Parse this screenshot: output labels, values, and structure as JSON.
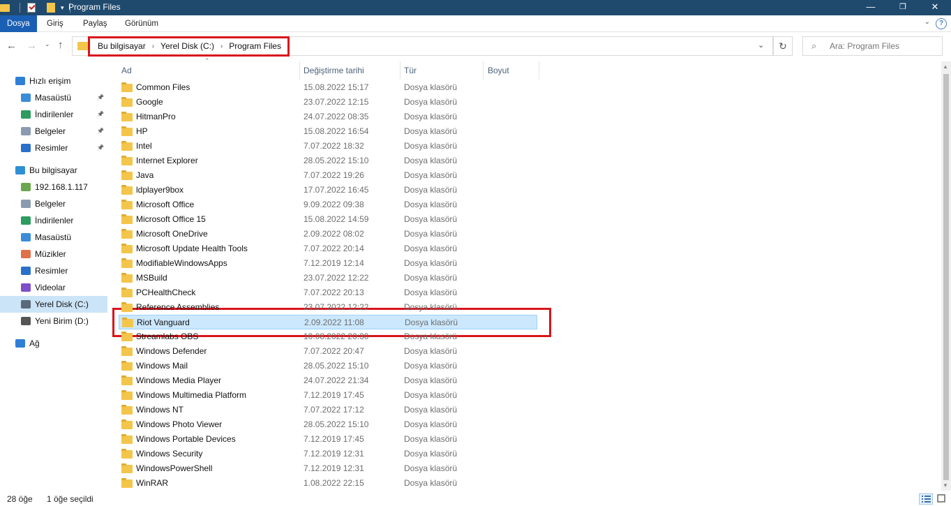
{
  "window": {
    "title": "Program Files",
    "minimize": "—",
    "maximize": "❐",
    "close": "✕"
  },
  "ribbon": {
    "tabs": [
      "Dosya",
      "Giriş",
      "Paylaş",
      "Görünüm"
    ]
  },
  "address": {
    "crumbs": [
      "Bu bilgisayar",
      "Yerel Disk (C:)",
      "Program Files"
    ]
  },
  "search": {
    "placeholder": "Ara: Program Files"
  },
  "sidebar": {
    "items": [
      {
        "label": "Hızlı erişim",
        "icon": "star-icon",
        "pinned": false
      },
      {
        "label": "Masaüstü",
        "icon": "desktop-icon",
        "pinned": true
      },
      {
        "label": "İndirilenler",
        "icon": "download-icon",
        "pinned": true
      },
      {
        "label": "Belgeler",
        "icon": "documents-icon",
        "pinned": true
      },
      {
        "label": "Resimler",
        "icon": "pictures-icon",
        "pinned": true
      },
      {
        "label": "Bu bilgisayar",
        "icon": "computer-icon",
        "pinned": false
      },
      {
        "label": "192.168.1.117",
        "icon": "network-drive-icon",
        "pinned": false
      },
      {
        "label": "Belgeler",
        "icon": "documents-icon",
        "pinned": false
      },
      {
        "label": "İndirilenler",
        "icon": "download-icon",
        "pinned": false
      },
      {
        "label": "Masaüstü",
        "icon": "desktop-icon",
        "pinned": false
      },
      {
        "label": "Müzikler",
        "icon": "music-icon",
        "pinned": false
      },
      {
        "label": "Resimler",
        "icon": "pictures-icon",
        "pinned": false
      },
      {
        "label": "Videolar",
        "icon": "videos-icon",
        "pinned": false
      },
      {
        "label": "Yerel Disk (C:)",
        "icon": "local-disk-icon",
        "pinned": false,
        "selected": true
      },
      {
        "label": "Yeni Birim (D:)",
        "icon": "drive-icon",
        "pinned": false
      },
      {
        "label": "Ağ",
        "icon": "network-icon",
        "pinned": false
      }
    ]
  },
  "columns": {
    "name": "Ad",
    "date": "Değiştirme tarihi",
    "type": "Tür",
    "size": "Boyut"
  },
  "files": [
    {
      "name": "Common Files",
      "date": "15.08.2022 15:17",
      "type": "Dosya klasörü"
    },
    {
      "name": "Google",
      "date": "23.07.2022 12:15",
      "type": "Dosya klasörü"
    },
    {
      "name": "HitmanPro",
      "date": "24.07.2022 08:35",
      "type": "Dosya klasörü"
    },
    {
      "name": "HP",
      "date": "15.08.2022 16:54",
      "type": "Dosya klasörü"
    },
    {
      "name": "Intel",
      "date": "7.07.2022 18:32",
      "type": "Dosya klasörü"
    },
    {
      "name": "Internet Explorer",
      "date": "28.05.2022 15:10",
      "type": "Dosya klasörü"
    },
    {
      "name": "Java",
      "date": "7.07.2022 19:26",
      "type": "Dosya klasörü"
    },
    {
      "name": "ldplayer9box",
      "date": "17.07.2022 16:45",
      "type": "Dosya klasörü"
    },
    {
      "name": "Microsoft Office",
      "date": "9.09.2022 09:38",
      "type": "Dosya klasörü"
    },
    {
      "name": "Microsoft Office 15",
      "date": "15.08.2022 14:59",
      "type": "Dosya klasörü"
    },
    {
      "name": "Microsoft OneDrive",
      "date": "2.09.2022 08:02",
      "type": "Dosya klasörü"
    },
    {
      "name": "Microsoft Update Health Tools",
      "date": "7.07.2022 20:14",
      "type": "Dosya klasörü"
    },
    {
      "name": "ModifiableWindowsApps",
      "date": "7.12.2019 12:14",
      "type": "Dosya klasörü"
    },
    {
      "name": "MSBuild",
      "date": "23.07.2022 12:22",
      "type": "Dosya klasörü"
    },
    {
      "name": "PCHealthCheck",
      "date": "7.07.2022 20:13",
      "type": "Dosya klasörü"
    },
    {
      "name": "Reference Assemblies",
      "date": "23.07.2022 12:22",
      "type": "Dosya klasörü"
    },
    {
      "name": "Riot Vanguard",
      "date": "2.09.2022 11:08",
      "type": "Dosya klasörü",
      "selected": true
    },
    {
      "name": "Streamlabs OBS",
      "date": "10.08.2022 20:30",
      "type": "Dosya klasörü"
    },
    {
      "name": "Windows Defender",
      "date": "7.07.2022 20:47",
      "type": "Dosya klasörü"
    },
    {
      "name": "Windows Mail",
      "date": "28.05.2022 15:10",
      "type": "Dosya klasörü"
    },
    {
      "name": "Windows Media Player",
      "date": "24.07.2022 21:34",
      "type": "Dosya klasörü"
    },
    {
      "name": "Windows Multimedia Platform",
      "date": "7.12.2019 17:45",
      "type": "Dosya klasörü"
    },
    {
      "name": "Windows NT",
      "date": "7.07.2022 17:12",
      "type": "Dosya klasörü"
    },
    {
      "name": "Windows Photo Viewer",
      "date": "28.05.2022 15:10",
      "type": "Dosya klasörü"
    },
    {
      "name": "Windows Portable Devices",
      "date": "7.12.2019 17:45",
      "type": "Dosya klasörü"
    },
    {
      "name": "Windows Security",
      "date": "7.12.2019 12:31",
      "type": "Dosya klasörü"
    },
    {
      "name": "WindowsPowerShell",
      "date": "7.12.2019 12:31",
      "type": "Dosya klasörü"
    },
    {
      "name": "WinRAR",
      "date": "1.08.2022 22:15",
      "type": "Dosya klasörü"
    }
  ],
  "status": {
    "count": "28 öğe",
    "selected": "1 öğe seçildi"
  },
  "colors": {
    "titlebar": "#1f4a6e",
    "accent": "#1a5fb4",
    "folder": "#f3c54a",
    "highlight_box": "#d9141b",
    "selection": "#cce8ff"
  }
}
